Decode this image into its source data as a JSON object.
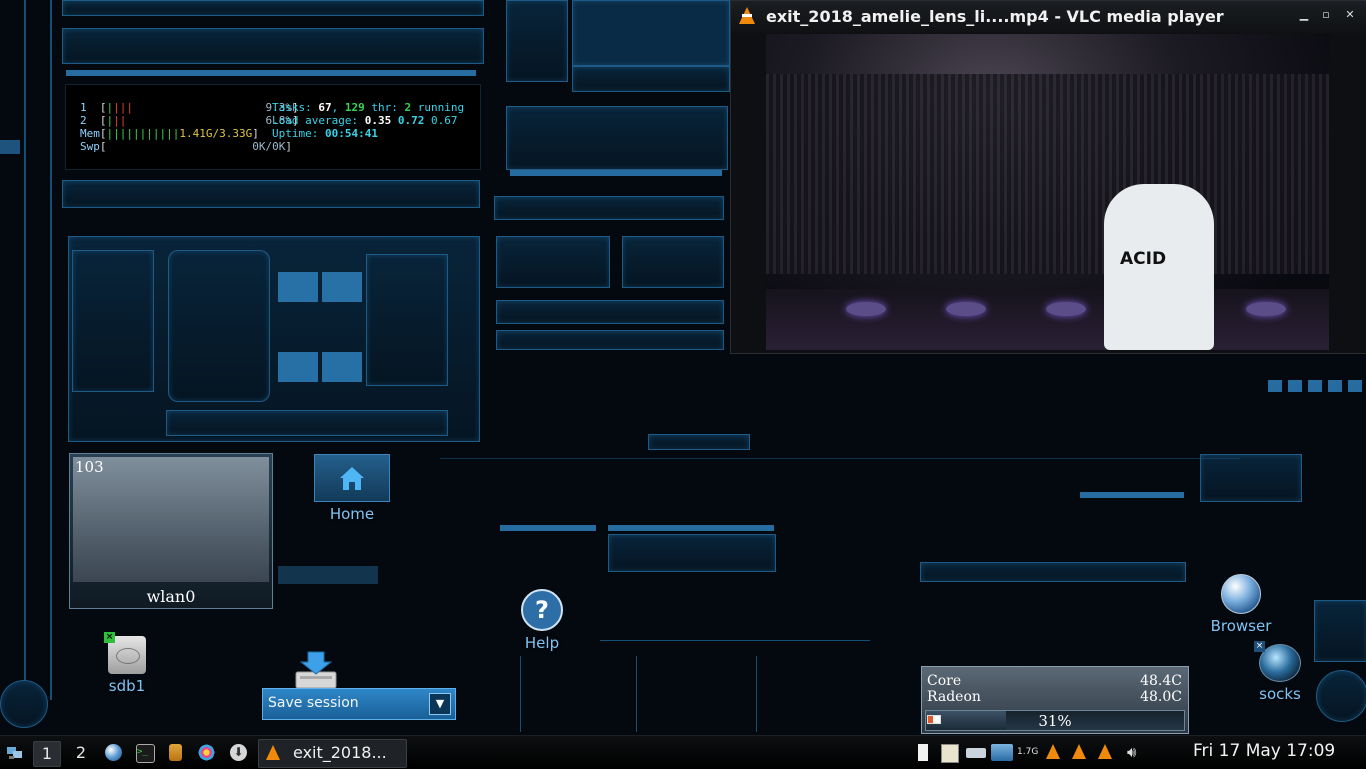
{
  "htop": {
    "cpu1_label": "1",
    "cpu1_value": "9.3%",
    "cpu2_label": "2",
    "cpu2_value": "6.8%",
    "mem_label": "Mem",
    "mem_value": "1.41G/3.33G",
    "swp_label": "Swp",
    "swp_value": "0K/0K",
    "tasks_label": "Tasks:",
    "tasks": "67",
    "threads": "129",
    "thr_label": "thr:",
    "running": "2",
    "running_label": "running",
    "load_label": "Load average:",
    "load1": "0.35",
    "load5": "0.72",
    "load15": "0.67",
    "uptime_label": "Uptime:",
    "uptime": "00:54:41"
  },
  "vlc": {
    "title": "exit_2018_amelie_lens_li....mp4 - VLC media player",
    "shirt_text": "ACID"
  },
  "wlan": {
    "value": "103",
    "label": "wlan0"
  },
  "desktop_icons": {
    "home": "Home",
    "help": "Help",
    "sdb1": "sdb1",
    "browser": "Browser",
    "socks": "socks"
  },
  "save_session": {
    "label": "Save session"
  },
  "temps": {
    "core_label": "Core",
    "core_value": "48.4C",
    "radeon_label": "Radeon",
    "radeon_value": "48.0C",
    "battery_percent": "31%",
    "battery_fraction": 0.31
  },
  "taskbar": {
    "workspace_1": "1",
    "workspace_2": "2",
    "task_label": "exit_2018...",
    "net_speed": "1.7G",
    "clock": "Fri 17 May 17:09"
  },
  "colors": {
    "accent": "#2f86c4",
    "vlc_orange": "#f08a0c",
    "background": "#03070c"
  },
  "icons": {
    "launcher": "network-icon",
    "browser_launcher": "globe-icon",
    "terminal_launcher": "terminal-icon",
    "files_launcher": "folder-icon",
    "apps_launcher": "flower-icon",
    "download_launcher": "download-icon"
  }
}
